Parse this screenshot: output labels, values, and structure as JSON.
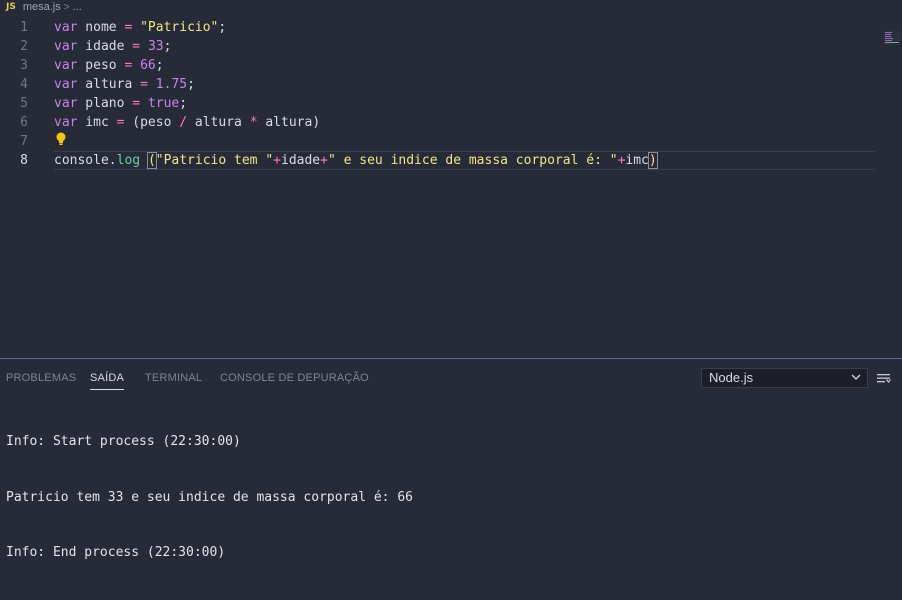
{
  "breadcrumb": {
    "file_icon": "JS",
    "file_name": "mesa.js",
    "separator": ">",
    "rest": "..."
  },
  "editor": {
    "active_line": 8,
    "lines": [
      {
        "number": "1",
        "tokens": [
          [
            "kw",
            "var"
          ],
          [
            "t",
            " nome "
          ],
          [
            "op",
            "="
          ],
          [
            "t",
            " "
          ],
          [
            "str",
            "\"Patricio\""
          ],
          [
            "t",
            ";"
          ]
        ]
      },
      {
        "number": "2",
        "tokens": [
          [
            "kw",
            "var"
          ],
          [
            "t",
            " idade "
          ],
          [
            "op",
            "="
          ],
          [
            "t",
            " "
          ],
          [
            "num",
            "33"
          ],
          [
            "t",
            ";"
          ]
        ]
      },
      {
        "number": "3",
        "tokens": [
          [
            "kw",
            "var"
          ],
          [
            "t",
            " peso "
          ],
          [
            "op",
            "="
          ],
          [
            "t",
            " "
          ],
          [
            "num",
            "66"
          ],
          [
            "t",
            ";"
          ]
        ]
      },
      {
        "number": "4",
        "tokens": [
          [
            "kw",
            "var"
          ],
          [
            "t",
            " altura "
          ],
          [
            "op",
            "="
          ],
          [
            "t",
            " "
          ],
          [
            "num",
            "1.75"
          ],
          [
            "t",
            ";"
          ]
        ]
      },
      {
        "number": "5",
        "tokens": [
          [
            "kw",
            "var"
          ],
          [
            "t",
            " plano "
          ],
          [
            "op",
            "="
          ],
          [
            "t",
            " "
          ],
          [
            "num",
            "true"
          ],
          [
            "t",
            ";"
          ]
        ]
      },
      {
        "number": "6",
        "tokens": [
          [
            "kw",
            "var"
          ],
          [
            "t",
            " imc "
          ],
          [
            "op",
            "="
          ],
          [
            "t",
            " (peso "
          ],
          [
            "op",
            "/"
          ],
          [
            "t",
            " altura "
          ],
          [
            "op",
            "*"
          ],
          [
            "t",
            " altura)"
          ]
        ]
      },
      {
        "number": "7",
        "tokens": []
      },
      {
        "number": "8",
        "tokens": [
          [
            "t",
            "console"
          ],
          [
            "t",
            "."
          ],
          [
            "fn",
            "log"
          ],
          [
            "t",
            " "
          ],
          [
            "brace",
            "("
          ],
          [
            "str",
            "\"Patricio tem \""
          ],
          [
            "op",
            "+"
          ],
          [
            "t",
            "idade"
          ],
          [
            "op",
            "+"
          ],
          [
            "str",
            "\" e seu indice de massa corporal é: \""
          ],
          [
            "op",
            "+"
          ],
          [
            "t",
            "imc"
          ],
          [
            "brace",
            ")"
          ]
        ]
      }
    ]
  },
  "panel": {
    "tabs": [
      {
        "label": "PROBLEMAS",
        "active": false
      },
      {
        "label": "SAÍDA",
        "active": true
      },
      {
        "label": "TERMINAL",
        "active": false
      },
      {
        "label": "CONSOLE DE DEPURAÇÃO",
        "active": false
      }
    ],
    "output_channel": "Node.js",
    "output_lines": [
      "Info: Start process (22:30:00)",
      "Patricio tem 33 e seu indice de massa corporal é: 66",
      "Info: End process (22:30:00)"
    ]
  },
  "colors": {
    "keyword": "#c586e8",
    "string": "#f1e48a",
    "operator": "#ff79c6",
    "function": "#69d19c",
    "panel_border": "#7b5fa8"
  },
  "icons": {
    "bulb": "lightbulb-icon",
    "chevron": "chevron-down-icon",
    "list": "list-menu-icon",
    "file": "js-file-icon"
  }
}
